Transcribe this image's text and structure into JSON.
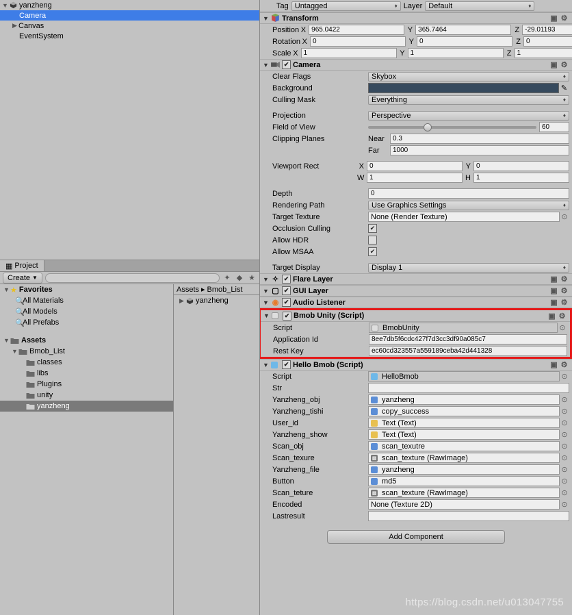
{
  "hierarchy": {
    "root": "yanzheng",
    "items": [
      "Camera",
      "Canvas",
      "EventSystem"
    ],
    "selected": "Camera"
  },
  "project": {
    "tab": "Project",
    "create": "Create",
    "breadcrumb": [
      "Assets",
      "Bmob_List"
    ],
    "favorites": {
      "label": "Favorites",
      "items": [
        "All Materials",
        "All Models",
        "All Prefabs"
      ]
    },
    "assets_root": "Assets",
    "folders": {
      "root": "Bmob_List",
      "children": [
        "classes",
        "libs",
        "Plugins",
        "unity",
        "yanzheng"
      ]
    },
    "asset_items": [
      "yanzheng"
    ]
  },
  "inspector": {
    "tag_label": "Tag",
    "tag_value": "Untagged",
    "layer_label": "Layer",
    "layer_value": "Default",
    "transform": {
      "title": "Transform",
      "position": {
        "label": "Position",
        "x": "965.0422",
        "y": "365.7464",
        "z": "-29.01193"
      },
      "rotation": {
        "label": "Rotation",
        "x": "0",
        "y": "0",
        "z": "0"
      },
      "scale": {
        "label": "Scale",
        "x": "1",
        "y": "1",
        "z": "1"
      }
    },
    "camera": {
      "title": "Camera",
      "clear_flags": {
        "label": "Clear Flags",
        "value": "Skybox"
      },
      "background": {
        "label": "Background"
      },
      "culling_mask": {
        "label": "Culling Mask",
        "value": "Everything"
      },
      "projection": {
        "label": "Projection",
        "value": "Perspective"
      },
      "fov": {
        "label": "Field of View",
        "value": "60"
      },
      "clip": {
        "label": "Clipping Planes",
        "near_l": "Near",
        "near": "0.3",
        "far_l": "Far",
        "far": "1000"
      },
      "viewport": {
        "label": "Viewport Rect",
        "x": "0",
        "y": "0",
        "w": "1",
        "h": "1"
      },
      "depth": {
        "label": "Depth",
        "value": "0"
      },
      "rendering_path": {
        "label": "Rendering Path",
        "value": "Use Graphics Settings"
      },
      "target_texture": {
        "label": "Target Texture",
        "value": "None (Render Texture)"
      },
      "occlusion": {
        "label": "Occlusion Culling",
        "checked": true
      },
      "hdr": {
        "label": "Allow HDR",
        "checked": false
      },
      "msaa": {
        "label": "Allow MSAA",
        "checked": true
      },
      "target_display": {
        "label": "Target Display",
        "value": "Display 1"
      }
    },
    "flare": {
      "title": "Flare Layer"
    },
    "gui": {
      "title": "GUI Layer"
    },
    "audio": {
      "title": "Audio Listener"
    },
    "bmob": {
      "title": "Bmob Unity (Script)",
      "script": {
        "label": "Script",
        "value": "BmobUnity"
      },
      "appid": {
        "label": "Application Id",
        "value": "8ee7db5f6cdc427f7d3cc3df90a085c7"
      },
      "restkey": {
        "label": "Rest Key",
        "value": "ec60cd323557a559189ceba42d441328"
      }
    },
    "hello": {
      "title": "Hello Bmob (Script)",
      "script": {
        "label": "Script",
        "value": "HelloBmob"
      },
      "str": {
        "label": "Str",
        "value": ""
      },
      "yz_obj": {
        "label": "Yanzheng_obj",
        "value": "yanzheng"
      },
      "yz_tishi": {
        "label": "Yanzheng_tishi",
        "value": "copy_success"
      },
      "user_id": {
        "label": "User_id",
        "value": "Text (Text)"
      },
      "yz_show": {
        "label": "Yanzheng_show",
        "value": "Text (Text)"
      },
      "scan_obj": {
        "label": "Scan_obj",
        "value": "scan_texutre"
      },
      "scan_texure": {
        "label": "Scan_texure",
        "value": "scan_texture (RawImage)"
      },
      "yz_file": {
        "label": "Yanzheng_file",
        "value": "yanzheng"
      },
      "button": {
        "label": "Button",
        "value": "md5"
      },
      "scan_teture": {
        "label": "Scan_teture",
        "value": "scan_texture (RawImage)"
      },
      "encoded": {
        "label": "Encoded",
        "value": "None (Texture 2D)"
      },
      "lastresult": {
        "label": "Lastresult",
        "value": ""
      }
    },
    "add_component": "Add Component"
  },
  "watermark": "https://blog.csdn.net/u013047755"
}
